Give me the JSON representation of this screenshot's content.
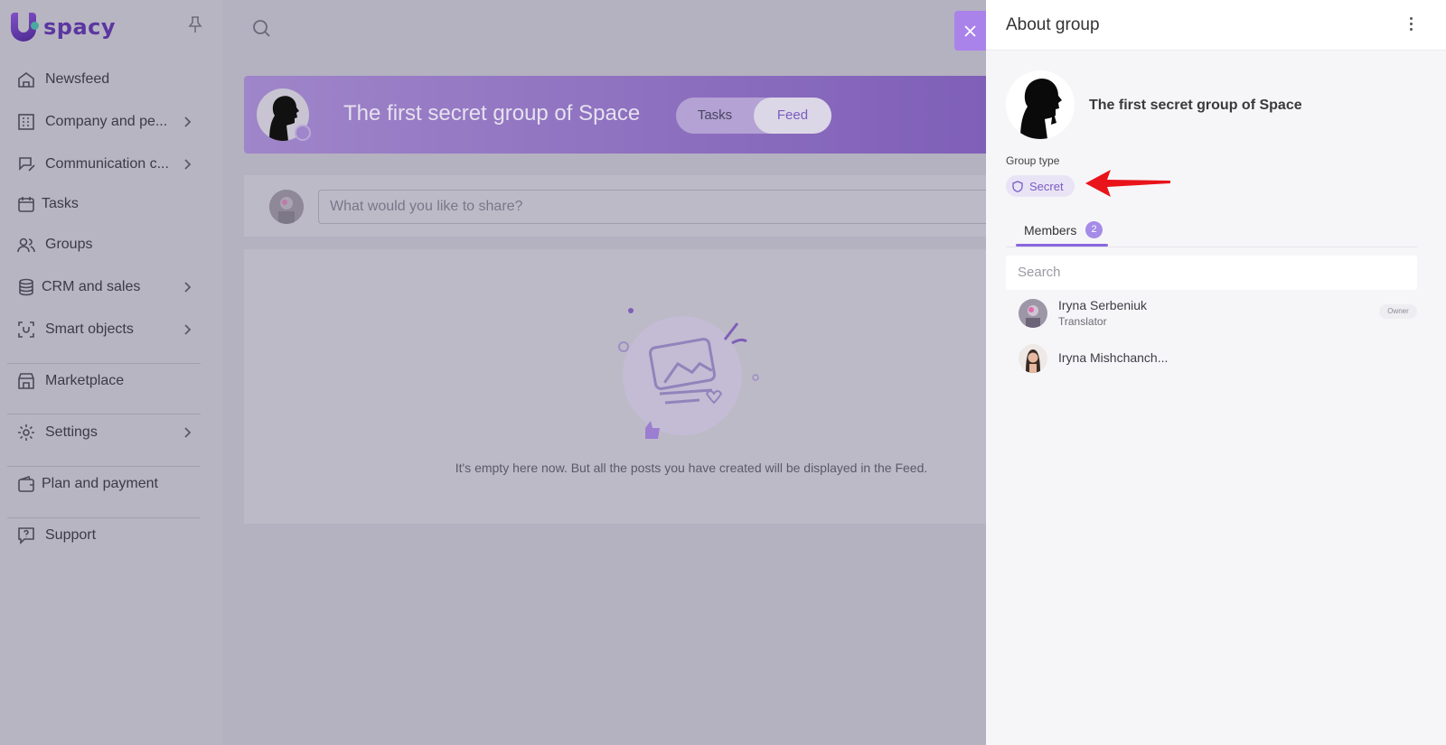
{
  "app": {
    "logo_text": "spacy"
  },
  "sidebar": {
    "items": [
      {
        "label": "Newsfeed",
        "icon": "home-icon",
        "has_submenu": false
      },
      {
        "label": "Company and pe...",
        "icon": "building-icon",
        "has_submenu": true
      },
      {
        "label": "Communication c...",
        "icon": "chat-edit-icon",
        "has_submenu": true
      },
      {
        "label": "Tasks",
        "icon": "calendar-icon",
        "has_submenu": false
      },
      {
        "label": "Groups",
        "icon": "users-icon",
        "has_submenu": false
      },
      {
        "label": "CRM and sales",
        "icon": "coins-icon",
        "has_submenu": true
      },
      {
        "label": "Smart objects",
        "icon": "scan-icon",
        "has_submenu": true
      },
      {
        "label": "Marketplace",
        "icon": "store-icon",
        "has_submenu": false
      },
      {
        "label": "Settings",
        "icon": "gear-icon",
        "has_submenu": true
      },
      {
        "label": "Plan and payment",
        "icon": "wallet-icon",
        "has_submenu": false
      },
      {
        "label": "Support",
        "icon": "help-icon",
        "has_submenu": false
      }
    ]
  },
  "main": {
    "group_title": "The first secret group of Space",
    "tabs": [
      {
        "label": "Tasks",
        "active": false
      },
      {
        "label": "Feed",
        "active": true
      }
    ],
    "compose_placeholder": "What would you like to share?",
    "empty_text": "It's empty here now. But all the posts you have created will be displayed in the Feed."
  },
  "panel": {
    "title": "About group",
    "group_name": "The first secret group of Space",
    "group_type_label": "Group type",
    "group_type_value": "Secret",
    "members_tab_label": "Members",
    "members_count": "2",
    "search_placeholder": "Search",
    "members": [
      {
        "name": "Iryna Serbeniuk",
        "role": "Translator",
        "badge": "Owner"
      },
      {
        "name": "Iryna Mishchanch...",
        "role": "",
        "badge": ""
      }
    ]
  },
  "colors": {
    "accent": "#8a66df",
    "close_button": "#a982ea",
    "annotation_arrow": "#e8141a"
  }
}
